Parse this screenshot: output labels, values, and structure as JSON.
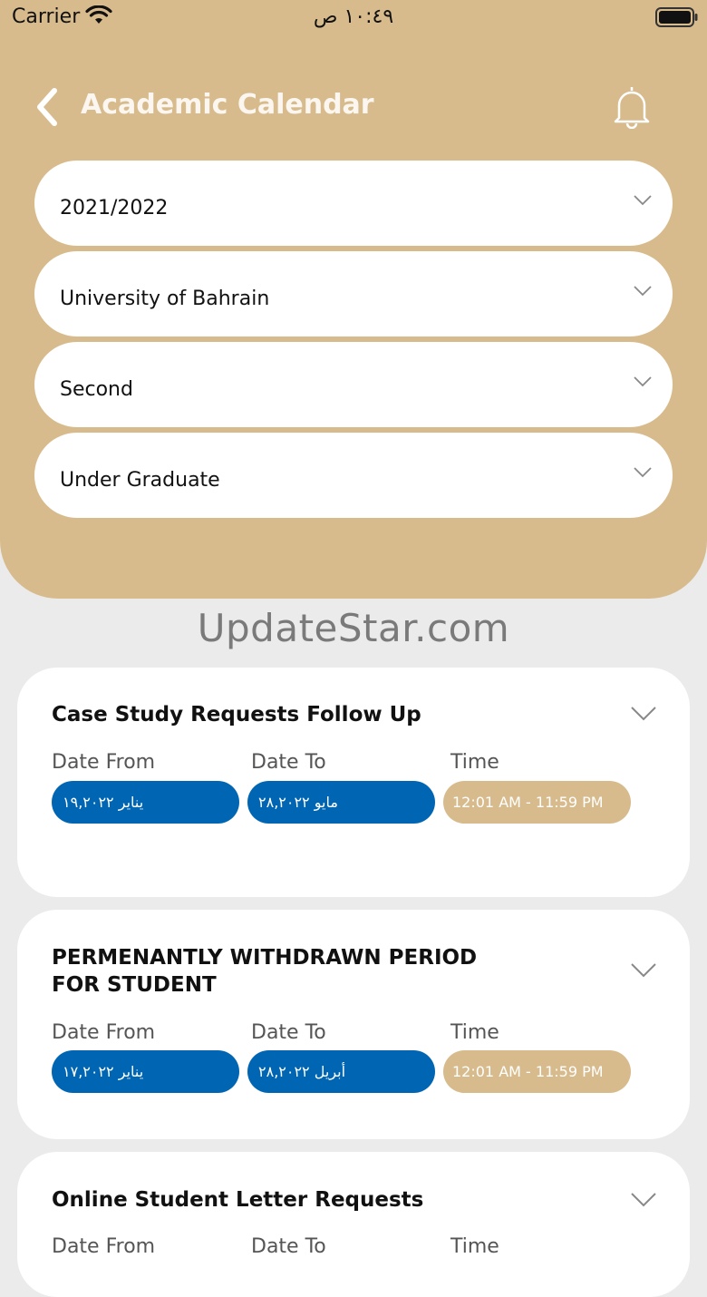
{
  "status_bar": {
    "carrier": "Carrier",
    "time": "١٠:٤٩ ص"
  },
  "header": {
    "title": "Academic Calendar"
  },
  "filters": {
    "year": "2021/2022",
    "university": "University of Bahrain",
    "semester": "Second",
    "level": "Under Graduate"
  },
  "watermark": "UpdateStar.com",
  "columns": {
    "from": "Date From",
    "to": "Date To",
    "time": "Time"
  },
  "events": [
    {
      "title": "Case Study Requests Follow Up",
      "from": "يناير ١٩,٢٠٢٢",
      "to": "مايو ٢٨,٢٠٢٢",
      "time": "12:01 AM - 11:59 PM"
    },
    {
      "title": "PERMENANTLY WITHDRAWN PERIOD FOR STUDENT",
      "from": "يناير ١٧,٢٠٢٢",
      "to": "أبريل ٢٨,٢٠٢٢",
      "time": "12:01 AM - 11:59 PM"
    },
    {
      "title": "Online Student Letter Requests"
    }
  ]
}
